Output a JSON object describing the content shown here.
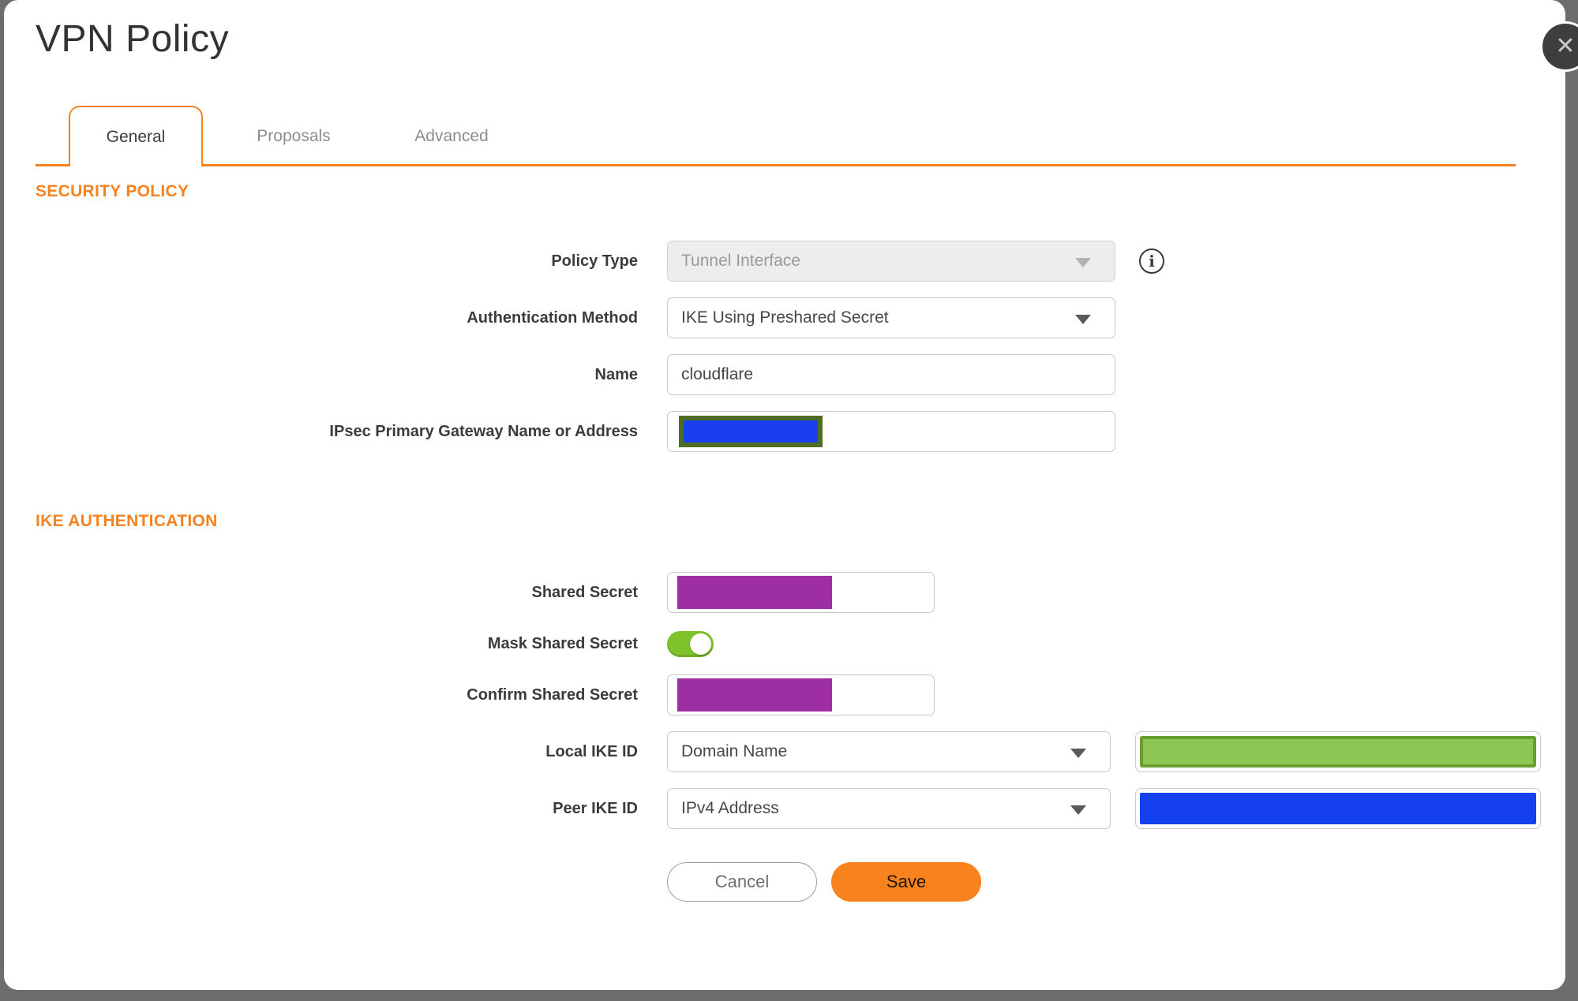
{
  "dialog": {
    "title": "VPN Policy"
  },
  "icons": {
    "close": "✕",
    "info": "i"
  },
  "tabs": [
    {
      "label": "General",
      "active": true
    },
    {
      "label": "Proposals",
      "active": false
    },
    {
      "label": "Advanced",
      "active": false
    }
  ],
  "sections": {
    "security_policy": {
      "heading": "SECURITY POLICY"
    },
    "ike_authentication": {
      "heading": "IKE AUTHENTICATION"
    }
  },
  "fields": {
    "policy_type": {
      "label": "Policy Type",
      "value": "Tunnel Interface",
      "disabled": true
    },
    "authentication_method": {
      "label": "Authentication Method",
      "value": "IKE Using Preshared Secret"
    },
    "name": {
      "label": "Name",
      "value": "cloudflare"
    },
    "ipsec_primary_gateway": {
      "label": "IPsec Primary Gateway Name or Address",
      "redaction": {
        "fill": "#1b3ff0",
        "border": "#4e6d22"
      }
    },
    "shared_secret": {
      "label": "Shared Secret",
      "redaction": {
        "fill": "#9e2fa3"
      }
    },
    "mask_shared_secret": {
      "label": "Mask Shared Secret",
      "state": "on"
    },
    "confirm_shared_secret": {
      "label": "Confirm Shared Secret",
      "redaction": {
        "fill": "#9e2fa3"
      }
    },
    "local_ike_id": {
      "label": "Local IKE ID",
      "type_value": "Domain Name",
      "redaction": {
        "fill": "#8dc653",
        "border": "#68a02e"
      }
    },
    "peer_ike_id": {
      "label": "Peer IKE ID",
      "type_value": "IPv4 Address",
      "redaction": {
        "fill": "#1540ee"
      }
    }
  },
  "buttons": {
    "cancel": "Cancel",
    "save": "Save"
  },
  "colors": {
    "accent_orange": "#f6821f",
    "save_button_orange": "#f8821d",
    "toggle_green": "#7fc32c",
    "backdrop_gray": "#6d6d6d",
    "close_button_gray": "#3e3e3e"
  }
}
